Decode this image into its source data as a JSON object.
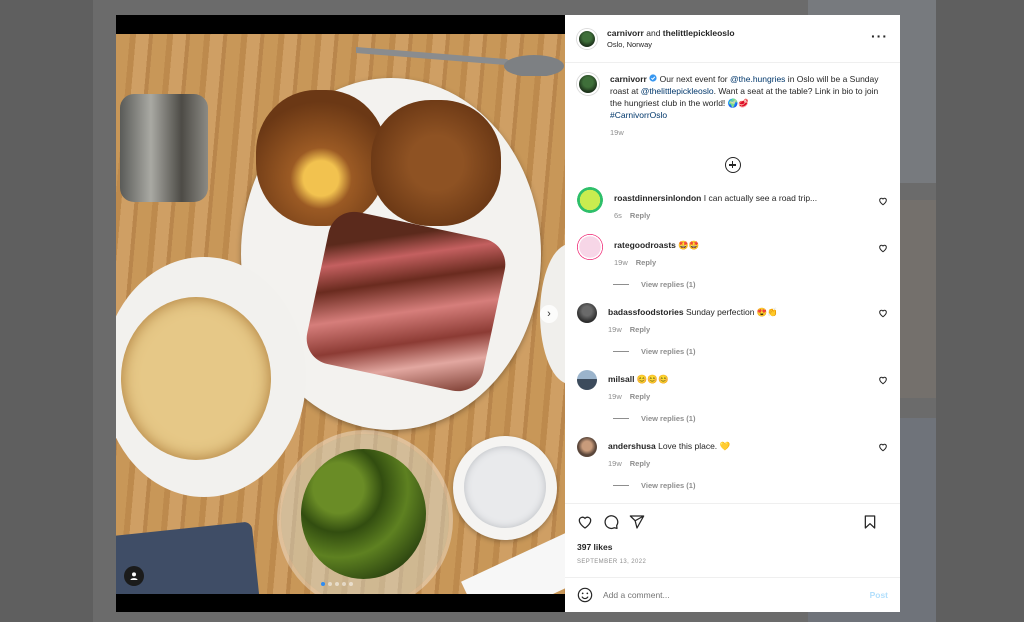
{
  "post": {
    "header": {
      "author": "carnivorr",
      "joiner": "and",
      "coauthor": "thelittlepickleoslo",
      "location": "Oslo, Norway"
    },
    "caption": {
      "username": "carnivorr",
      "verified_badge": "verified-badge-icon",
      "text_1": "Our next event for ",
      "mention_1": "@the.hungries",
      "text_2": " in Oslo will be a Sunday roast at ",
      "mention_2": "@thelittlepickleoslo",
      "text_3": ". Want a seat at the table? Link in bio to join the hungriest club in the world! 🌍🥩",
      "hashtag": "#CarnivorrOslo",
      "age": "19w"
    },
    "comments": [
      {
        "username": "roastdinnersinlondon",
        "text": "I can actually see a road trip...",
        "age": "6s",
        "reply": "Reply",
        "view_replies": ""
      },
      {
        "username": "rategoodroasts",
        "text": "🤩🤩",
        "age": "19w",
        "reply": "Reply",
        "view_replies": "View replies (1)"
      },
      {
        "username": "badassfoodstories",
        "text": "Sunday perfection 😍👏",
        "age": "19w",
        "reply": "Reply",
        "view_replies": "View replies (1)"
      },
      {
        "username": "milsall",
        "text": "😊😊😊",
        "age": "19w",
        "reply": "Reply",
        "view_replies": "View replies (1)"
      },
      {
        "username": "andershusa",
        "text": "Love this place. 💛",
        "age": "19w",
        "reply": "Reply",
        "view_replies": "View replies (1)"
      }
    ],
    "likes": "397 likes",
    "date": "SEPTEMBER 13, 2022",
    "add_comment_placeholder": "Add a comment...",
    "post_button": "Post"
  },
  "media": {
    "carousel_dots": 5,
    "active_dot": 0,
    "icons": [
      "user-tag-icon",
      "chevron-right-icon"
    ]
  },
  "colors": {
    "link": "#00376b",
    "muted": "#8e8e8e",
    "post_button": "#b2dffc",
    "carousel_active": "#2f8cf0"
  }
}
